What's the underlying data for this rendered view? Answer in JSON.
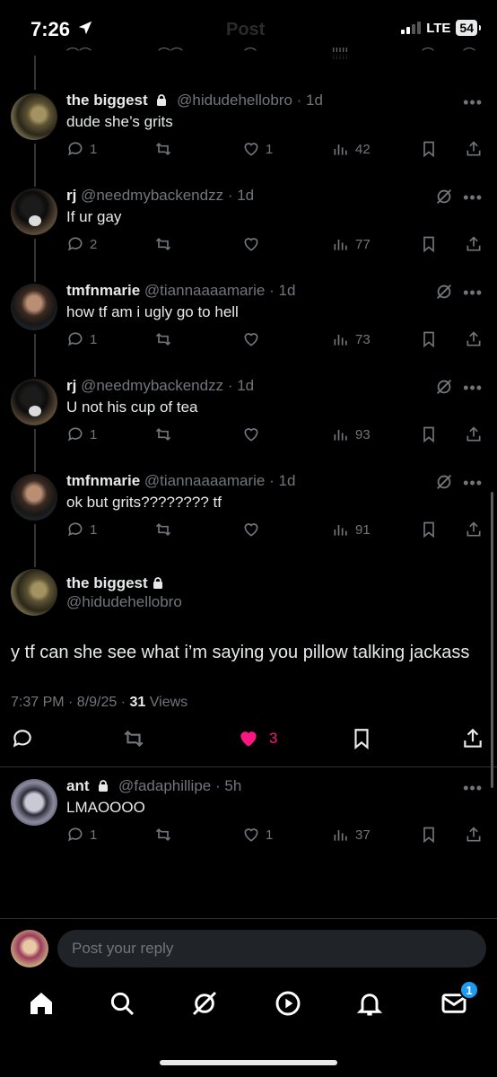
{
  "status": {
    "time": "7:26",
    "network": "LTE",
    "battery": "54"
  },
  "header": {
    "faded_title": "Post"
  },
  "replies": [
    {
      "name": "the biggest",
      "locked": true,
      "handle": "@hidudehellobro",
      "age": "1d",
      "text": "dude she’s grits",
      "replies": "1",
      "likes": "1",
      "views": "42",
      "grok": false
    },
    {
      "name": "rj",
      "locked": false,
      "handle": "@needmybackendzz",
      "age": "1d",
      "text": "If ur gay",
      "replies": "2",
      "likes": "",
      "views": "77",
      "grok": true
    },
    {
      "name": "tmfnmarie",
      "locked": false,
      "handle": "@tiannaaaamarie",
      "age": "1d",
      "text": "how tf am i ugly go to hell",
      "replies": "1",
      "likes": "",
      "views": "73",
      "grok": true
    },
    {
      "name": "rj",
      "locked": false,
      "handle": "@needmybackendzz",
      "age": "1d",
      "text": "U not his cup of tea",
      "replies": "1",
      "likes": "",
      "views": "93",
      "grok": true
    },
    {
      "name": "tmfnmarie",
      "locked": false,
      "handle": "@tiannaaaamarie",
      "age": "1d",
      "text": "ok but grits???????? tf",
      "replies": "1",
      "likes": "",
      "views": "91",
      "grok": true
    }
  ],
  "main_post": {
    "name": "the biggest",
    "handle": "@hidudehellobro",
    "text": "y tf can she see what i’m saying you pillow talking jackass",
    "time": "7:37 PM · 8/9/25 · ",
    "views_count": "31",
    "views_label": " Views",
    "likes": "3",
    "like_color": "#f91880"
  },
  "bottom_reply": {
    "name": "ant",
    "handle": "@fadaphillipe",
    "age": "5h",
    "text": "LMAOOOO",
    "replies": "1",
    "likes": "1",
    "views": "37"
  },
  "composer": {
    "placeholder": "Post your reply"
  },
  "tabbar": {
    "messages_badge": "1"
  },
  "icons": [
    "home-icon",
    "search-icon",
    "grok-icon",
    "video-icon",
    "bell-icon",
    "mail-icon"
  ]
}
